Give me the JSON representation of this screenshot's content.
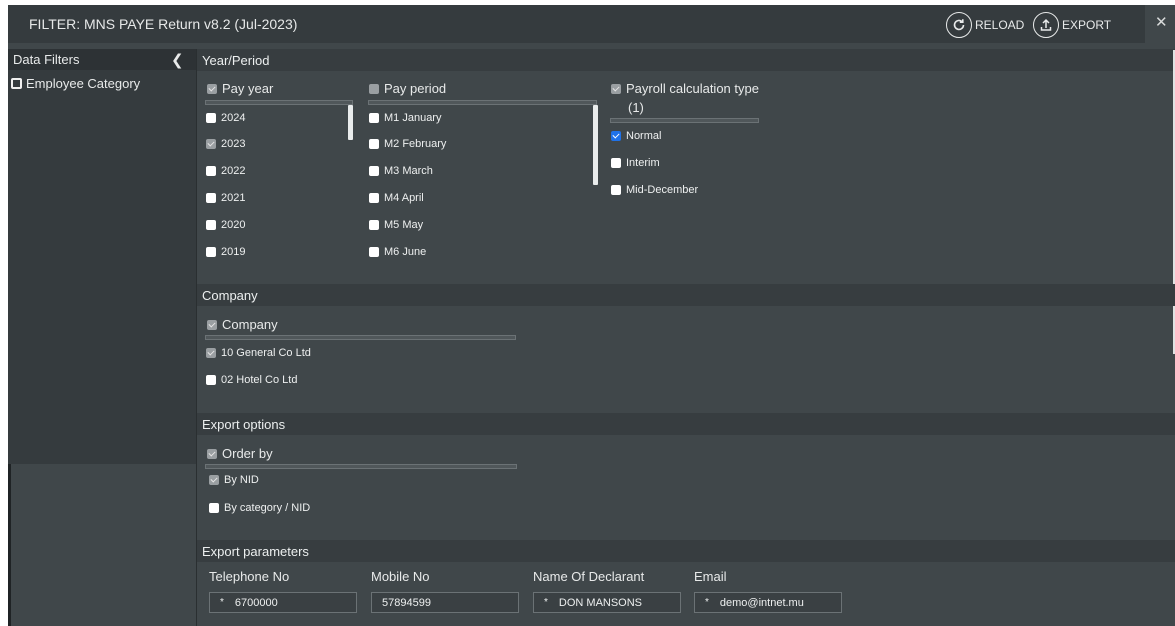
{
  "header": {
    "title": "FILTER: MNS PAYE Return v8.2 (Jul-2023)",
    "reload_label": "RELOAD",
    "export_label": "EXPORT",
    "close_glyph": "✕"
  },
  "sidebar": {
    "title": "Data Filters",
    "collapse_glyph": "❮",
    "items": [
      {
        "label": "Employee Category",
        "checked": false
      }
    ]
  },
  "sections": {
    "year_period": "Year/Period",
    "company": "Company",
    "export_options": "Export options",
    "export_parameters": "Export parameters"
  },
  "pay_year": {
    "title": "Pay year",
    "options": [
      {
        "label": "2024",
        "state": "unchecked"
      },
      {
        "label": "2023",
        "state": "checked-grey"
      },
      {
        "label": "2022",
        "state": "unchecked"
      },
      {
        "label": "2021",
        "state": "unchecked"
      },
      {
        "label": "2020",
        "state": "unchecked"
      },
      {
        "label": "2019",
        "state": "unchecked"
      }
    ]
  },
  "pay_period": {
    "title": "Pay period",
    "options": [
      {
        "label": "M1 January",
        "state": "unchecked"
      },
      {
        "label": "M2 February",
        "state": "unchecked"
      },
      {
        "label": "M3 March",
        "state": "unchecked"
      },
      {
        "label": "M4 April",
        "state": "unchecked"
      },
      {
        "label": "M5 May",
        "state": "unchecked"
      },
      {
        "label": "M6 June",
        "state": "unchecked"
      }
    ]
  },
  "payroll_calc": {
    "title": "Payroll calculation type",
    "count": "(1)",
    "options": [
      {
        "label": "Normal",
        "state": "checked-blue"
      },
      {
        "label": "Interim",
        "state": "unchecked"
      },
      {
        "label": "Mid-December",
        "state": "unchecked"
      }
    ]
  },
  "company": {
    "title": "Company",
    "options": [
      {
        "label": "10 General Co Ltd",
        "state": "checked-grey"
      },
      {
        "label": "02 Hotel Co Ltd",
        "state": "unchecked"
      }
    ]
  },
  "order_by": {
    "title": "Order by",
    "options": [
      {
        "label": "By NID",
        "state": "checked-grey"
      },
      {
        "label": "By category / NID",
        "state": "unchecked"
      }
    ]
  },
  "parameters": {
    "telephone": {
      "label": "Telephone No",
      "value": "6700000",
      "required": "*"
    },
    "mobile": {
      "label": "Mobile No",
      "value": "57894599",
      "required": ""
    },
    "declarant": {
      "label": "Name Of Declarant",
      "value": "DON MANSONS",
      "required": "*"
    },
    "email": {
      "label": "Email",
      "value": "demo@intnet.mu",
      "required": "*"
    }
  },
  "colors": {
    "panel_bg": "#40474a",
    "header_bg": "#353b3e",
    "check_blue": "#1f72e8",
    "check_grey": "#9a9fa2"
  }
}
